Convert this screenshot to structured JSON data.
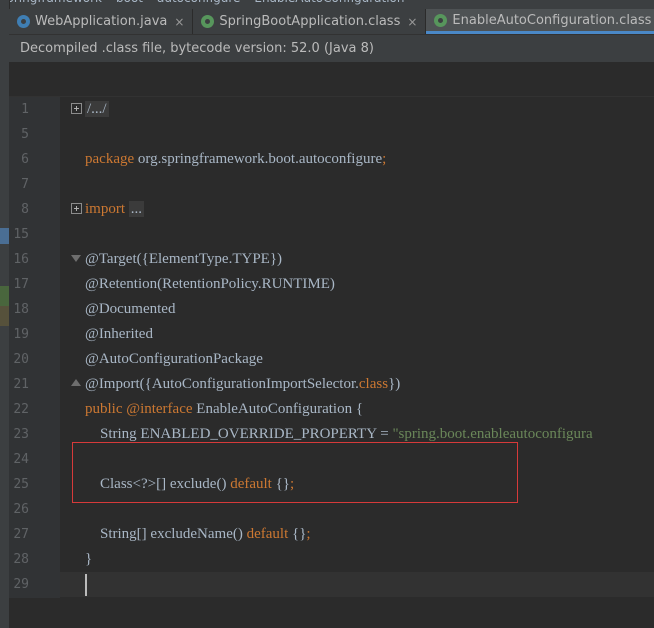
{
  "breadcrumbs": [
    "springframework",
    "boot",
    "autoconfigure",
    "EnableAutoConfiguration"
  ],
  "tabs": [
    {
      "label": "WebApplication.java",
      "type": "java",
      "active": false
    },
    {
      "label": "SpringBootApplication.class",
      "type": "class",
      "active": false
    },
    {
      "label": "EnableAutoConfiguration.class",
      "type": "class",
      "active": true
    }
  ],
  "notice": "Decompiled .class file, bytecode version: 52.0 (Java 8)",
  "lines": [
    {
      "n": "1",
      "fold": "plus",
      "segs": [
        {
          "t": "/.../",
          "c": "folded"
        }
      ]
    },
    {
      "n": "5",
      "segs": []
    },
    {
      "n": "6",
      "segs": [
        {
          "t": "package",
          "c": "kw"
        },
        {
          "t": " org.springframework.boot.autoconfigure"
        },
        {
          "t": ";",
          "c": "kw"
        }
      ]
    },
    {
      "n": "7",
      "segs": []
    },
    {
      "n": "8",
      "fold": "plus",
      "segs": [
        {
          "t": "import",
          "c": "kw"
        },
        {
          "t": " "
        },
        {
          "t": "...",
          "c": "folded"
        }
      ]
    },
    {
      "n": "15",
      "segs": []
    },
    {
      "n": "16",
      "fold": "tri",
      "segs": [
        {
          "t": "@Target({ElementType.TYPE})"
        }
      ]
    },
    {
      "n": "17",
      "segs": [
        {
          "t": "@Retention(RetentionPolicy.RUNTIME)"
        }
      ]
    },
    {
      "n": "18",
      "segs": [
        {
          "t": "@Documented"
        }
      ]
    },
    {
      "n": "19",
      "segs": [
        {
          "t": "@Inherited"
        }
      ]
    },
    {
      "n": "20",
      "segs": [
        {
          "t": "@AutoConfigurationPackage"
        }
      ]
    },
    {
      "n": "21",
      "fold": "tri-up",
      "segs": [
        {
          "t": "@Import({AutoConfigurationImportSelector."
        },
        {
          "t": "class",
          "c": "kw"
        },
        {
          "t": "})"
        }
      ]
    },
    {
      "n": "22",
      "segs": [
        {
          "t": "public",
          "c": "kw"
        },
        {
          "t": " "
        },
        {
          "t": "@interface",
          "c": "kw"
        },
        {
          "t": " EnableAutoConfiguration {"
        }
      ]
    },
    {
      "n": "23",
      "segs": [
        {
          "t": "    String ENABLED_OVERRIDE_PROPERTY = "
        },
        {
          "t": "\"spring.boot.enableautoconfigura",
          "c": "str"
        }
      ]
    },
    {
      "n": "24",
      "segs": []
    },
    {
      "n": "25",
      "segs": [
        {
          "t": "    Class<?>[] exclude() "
        },
        {
          "t": "default",
          "c": "kw"
        },
        {
          "t": " {}"
        },
        {
          "t": ";",
          "c": "kw"
        }
      ]
    },
    {
      "n": "26",
      "segs": []
    },
    {
      "n": "27",
      "segs": [
        {
          "t": "    String[] excludeName() "
        },
        {
          "t": "default",
          "c": "kw"
        },
        {
          "t": " {}"
        },
        {
          "t": ";",
          "c": "kw"
        }
      ]
    },
    {
      "n": "28",
      "segs": [
        {
          "t": "}"
        }
      ]
    },
    {
      "n": "29",
      "segs": []
    }
  ],
  "colors": {
    "keyword": "#cc7832",
    "string": "#6a8759",
    "text": "#a9b7c6",
    "highlight": "#d63a3a",
    "active_tab": "#4a88c7"
  }
}
